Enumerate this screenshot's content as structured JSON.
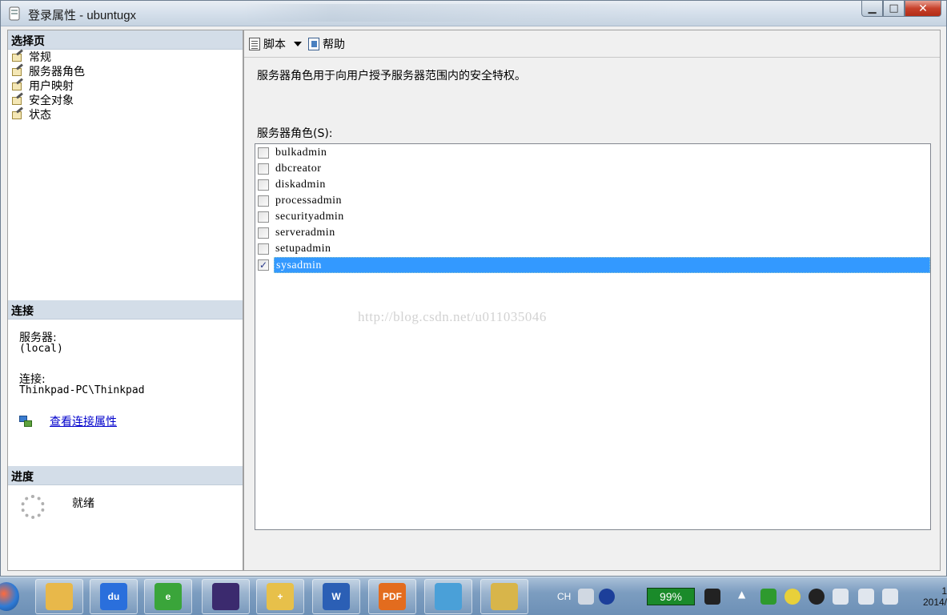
{
  "window": {
    "title": "登录属性 - ubuntugx",
    "close_glyph": "✕",
    "min_glyph": "▁",
    "max_glyph": "□"
  },
  "left": {
    "select_page_header": "选择页",
    "pages": [
      {
        "label": "常规"
      },
      {
        "label": "服务器角色"
      },
      {
        "label": "用户映射"
      },
      {
        "label": "安全对象"
      },
      {
        "label": "状态"
      }
    ],
    "connection_header": "连接",
    "server_label": "服务器:",
    "server_value": "(local)",
    "connection_label": "连接:",
    "connection_value": "Thinkpad-PC\\Thinkpad",
    "view_link": "查看连接属性",
    "progress_header": "进度",
    "progress_status": "就绪"
  },
  "toolbar": {
    "script_label": "脚本",
    "help_label": "帮助"
  },
  "main": {
    "description": "服务器角色用于向用户授予服务器范围内的安全特权。",
    "roles_label": "服务器角色(S):",
    "roles": [
      {
        "name": "bulkadmin",
        "checked": false,
        "selected": false
      },
      {
        "name": "dbcreator",
        "checked": false,
        "selected": false
      },
      {
        "name": "diskadmin",
        "checked": false,
        "selected": false
      },
      {
        "name": "processadmin",
        "checked": false,
        "selected": false
      },
      {
        "name": "securityadmin",
        "checked": false,
        "selected": false
      },
      {
        "name": "serveradmin",
        "checked": false,
        "selected": false
      },
      {
        "name": "setupadmin",
        "checked": false,
        "selected": false
      },
      {
        "name": "sysadmin",
        "checked": true,
        "selected": true
      }
    ],
    "watermark": "http://blog.csdn.net/u011035046"
  },
  "taskbar": {
    "apps": [
      {
        "name": "file-explorer-icon",
        "color": "#e8b84a",
        "text": ""
      },
      {
        "name": "baidu-icon",
        "color": "#2a6fdc",
        "text": "du"
      },
      {
        "name": "browser-e-icon",
        "color": "#3aa53a",
        "text": "e"
      },
      {
        "name": "eclipse-icon",
        "color": "#3b2a6e",
        "text": ""
      },
      {
        "name": "snipping-tool-icon",
        "color": "#e7c04a",
        "text": "+"
      },
      {
        "name": "word-icon",
        "color": "#2b5fb5",
        "text": "W"
      },
      {
        "name": "pdf-icon",
        "color": "#e36c1e",
        "text": "PDF"
      },
      {
        "name": "notepad-icon",
        "color": "#4aa0d8",
        "text": ""
      },
      {
        "name": "sql-tools-icon",
        "color": "#d8b54a",
        "text": ""
      }
    ],
    "ime": "CH",
    "battery": "99%",
    "clock_time": "1",
    "clock_date": "2014/"
  }
}
